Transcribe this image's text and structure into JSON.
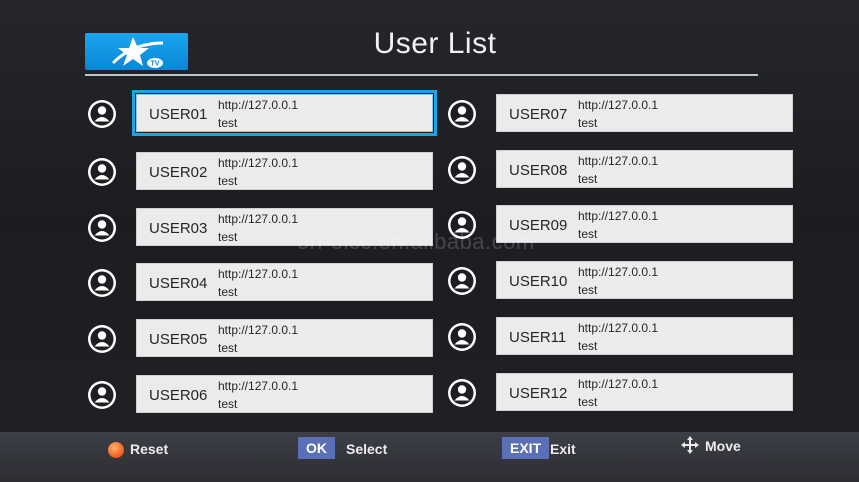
{
  "header": {
    "title": "User List",
    "logo_text": "TV"
  },
  "users": [
    {
      "name": "USER01",
      "url": "http://127.0.0.1",
      "password": "test",
      "selected": true
    },
    {
      "name": "USER02",
      "url": "http://127.0.0.1",
      "password": "test"
    },
    {
      "name": "USER03",
      "url": "http://127.0.0.1",
      "password": "test"
    },
    {
      "name": "USER04",
      "url": "http://127.0.0.1",
      "password": "test"
    },
    {
      "name": "USER05",
      "url": "http://127.0.0.1",
      "password": "test"
    },
    {
      "name": "USER06",
      "url": "http://127.0.0.1",
      "password": "test"
    },
    {
      "name": "USER07",
      "url": "http://127.0.0.1",
      "password": "test"
    },
    {
      "name": "USER08",
      "url": "http://127.0.0.1",
      "password": "test"
    },
    {
      "name": "USER09",
      "url": "http://127.0.0.1",
      "password": "test"
    },
    {
      "name": "USER10",
      "url": "http://127.0.0.1",
      "password": "test"
    },
    {
      "name": "USER11",
      "url": "http://127.0.0.1",
      "password": "test"
    },
    {
      "name": "USER12",
      "url": "http://127.0.0.1",
      "password": "test"
    }
  ],
  "footer": {
    "reset_label": "Reset",
    "ok_key": "OK",
    "select_label": "Select",
    "exit_key": "EXIT",
    "exit_label": "Exit",
    "move_label": "Move"
  },
  "watermark": "ori-olcc.en.alibaba.com",
  "icons": {
    "avatar": "user-avatar-icon",
    "reset": "red-dot-icon",
    "move": "four-way-arrow-icon"
  },
  "colors": {
    "selection": "#1fa2e6",
    "key_bg": "#5a6fb5",
    "reset_dot": "#f05a1a",
    "logo_bg": "#0a86d6"
  }
}
